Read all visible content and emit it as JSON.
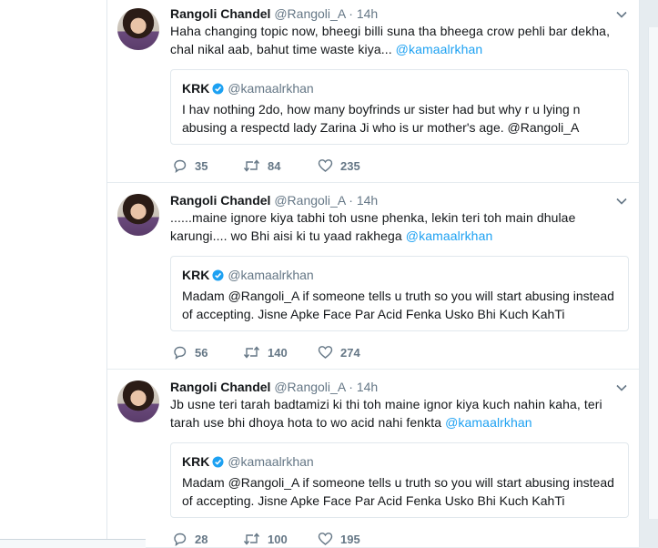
{
  "tweets": [
    {
      "author_name": "Rangoli Chandel",
      "author_handle": "@Rangoli_A",
      "separator": "·",
      "time": "14h",
      "text_lines": [
        {
          "text": "Haha changing topic now, bheegi billi suna tha bheega crow pehli bar dekha,",
          "mention": ""
        },
        {
          "text": "chal nikal aab, bahut time waste kiya... ",
          "mention": "@kamaalrkhan"
        }
      ],
      "quote": {
        "name": "KRK",
        "handle": "@kamaalrkhan",
        "lines": [
          "I hav nothing 2do, how many boyfrinds ur sister had but why r u lying n",
          "abusing a respectd lady Zarina Ji who is ur mother's age. @Rangoli_A"
        ]
      },
      "replies": "35",
      "retweets": "84",
      "likes": "235"
    },
    {
      "author_name": "Rangoli Chandel",
      "author_handle": "@Rangoli_A",
      "separator": "·",
      "time": "14h",
      "text_lines": [
        {
          "text": "......maine ignore kiya tabhi toh usne phenka, lekin teri toh main dhulae",
          "mention": ""
        },
        {
          "text": "karungi.... wo Bhi aisi ki tu yaad rakhega ",
          "mention": "@kamaalrkhan"
        }
      ],
      "quote": {
        "name": "KRK",
        "handle": "@kamaalrkhan",
        "lines": [
          "Madam @Rangoli_A if someone tells u truth so you will start abusing instead",
          "of accepting. Jisne Apke Face Par Acid Fenka Usko Bhi Kuch KahTi"
        ]
      },
      "replies": "56",
      "retweets": "140",
      "likes": "274"
    },
    {
      "author_name": "Rangoli Chandel",
      "author_handle": "@Rangoli_A",
      "separator": "·",
      "time": "14h",
      "text_lines": [
        {
          "text": "Jb usne teri tarah badtamizi ki thi toh maine ignor kiya kuch nahin kaha, teri",
          "mention": ""
        },
        {
          "text": "tarah use bhi dhoya hota to wo acid nahi fenkta ",
          "mention": "@kamaalrkhan"
        }
      ],
      "quote": {
        "name": "KRK",
        "handle": "@kamaalrkhan",
        "lines": [
          "Madam @Rangoli_A if someone tells u truth so you will start abusing instead",
          "of accepting. Jisne Apke Face Par Acid Fenka Usko Bhi Kuch KahTi"
        ]
      },
      "replies": "28",
      "retweets": "100",
      "likes": "195"
    }
  ],
  "icons": {
    "reply": "reply-icon",
    "retweet": "retweet-icon",
    "like": "heart-icon",
    "more": "chevron-down-icon",
    "verified": "verified-badge-icon"
  },
  "colors": {
    "link": "#1da1f2",
    "secondary": "#657786",
    "verified": "#1da1f2",
    "background": "#e6ecf0"
  }
}
